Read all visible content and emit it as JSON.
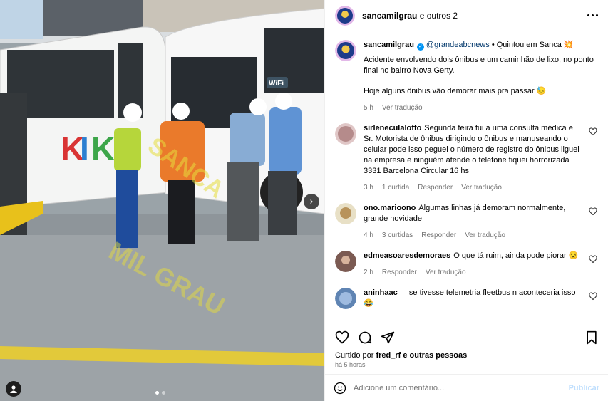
{
  "post": {
    "header_user": "sancamilgrau",
    "header_suffix": " e outros 2"
  },
  "caption": {
    "username": "sancamilgrau",
    "mention": "@grandeabcnews",
    "location": " • Quintou em Sanca 💥",
    "para1": "Acidente envolvendo dois ônibus e um caminhão de lixo, no ponto final no bairro Nova Gerty.",
    "para2": "Hoje alguns ônibus vão demorar mais pra passar 😓",
    "time": "5 h",
    "translate": "Ver tradução"
  },
  "comments": [
    {
      "user": "sirleneculaloffo",
      "text": "Segunda feira fui a uma consulta médica e Sr. Motorista de ônibus dirigindo o ônibus e manuseando o celular pode isso peguei o número de registro do ônibus liguei na empresa e ninguém atende o telefone fiquei horrorizada 3331 Barcelona Circular 16 hs",
      "time": "3 h",
      "likes": "1 curtida",
      "reply": "Responder",
      "translate": "Ver tradução"
    },
    {
      "user": "ono.marioono",
      "text": "Algumas linhas já demoram normalmente, grande novidade",
      "time": "4 h",
      "likes": "3 curtidas",
      "reply": "Responder",
      "translate": "Ver tradução"
    },
    {
      "user": "edmeasoaresdemoraes",
      "text": "O que tá ruim, ainda pode piorar 😒",
      "time": "2 h",
      "likes": "",
      "reply": "Responder",
      "translate": "Ver tradução"
    },
    {
      "user": "aninhaac__",
      "text": "se tivesse telemetria fleetbus n aconteceria isso 😂",
      "time": "",
      "likes": "",
      "reply": "",
      "translate": ""
    }
  ],
  "likes_line": {
    "prefix": "Curtido por ",
    "user": "fred_rf",
    "suffix": " e outras pessoas"
  },
  "post_time": "há 5 horas",
  "comment_box": {
    "placeholder": "Adicione um comentário...",
    "publish": "Publicar"
  },
  "media": {
    "watermark_top": "SANCA",
    "watermark_bottom": "MIL GRAU",
    "bus_sign": "WiFi",
    "carousel_count": 2,
    "carousel_active": 1
  },
  "colors": {
    "accent": "#0095f6",
    "link": "#00376b",
    "secondary_text": "#737373",
    "publish_disabled": "#c0dffd"
  },
  "icons": [
    "heart-icon",
    "comment-icon",
    "share-icon",
    "save-icon",
    "emoji-icon",
    "more-icon",
    "chevron-right-icon",
    "user-tag-icon",
    "verified-icon"
  ]
}
